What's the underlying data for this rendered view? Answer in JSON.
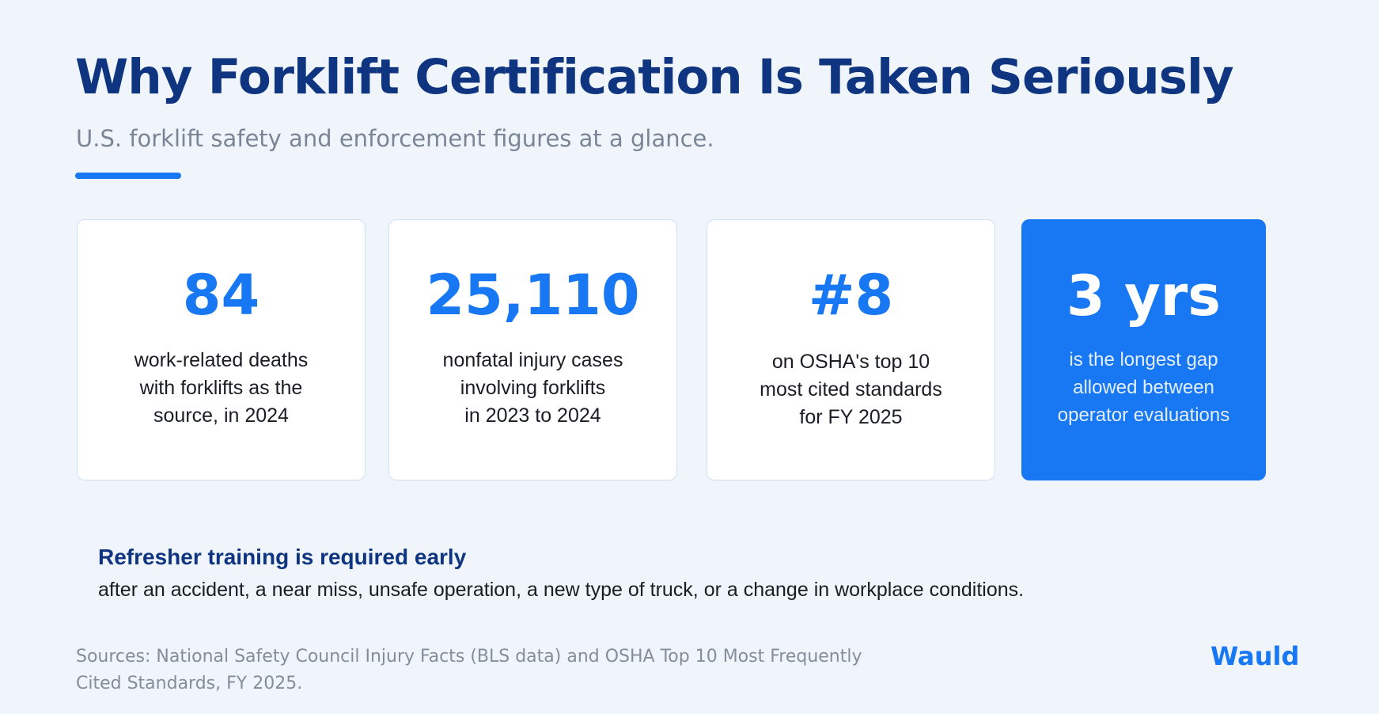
{
  "header": {
    "title": "Why Forklift Certification Is Taken Seriously",
    "subtitle": "U.S. forklift safety and enforcement figures at a glance."
  },
  "stats": [
    {
      "value": "84",
      "description": "work-related deaths with forklifts as the source, in 2024",
      "lines": [
        "work-related deaths",
        "with forklifts as the",
        "source, in 2024"
      ]
    },
    {
      "value": "25,110",
      "description": "nonfatal injury cases involving forklifts in 2023 to 2024",
      "lines": [
        "nonfatal injury cases",
        "involving forklifts",
        "in 2023 to 2024"
      ]
    },
    {
      "value": "#8",
      "description": "on OSHA's top 10 most cited standards for FY 2025",
      "lines": [
        "on OSHA's top 10",
        "most cited standards",
        "for FY 2025"
      ]
    },
    {
      "value": "3 yrs",
      "description": "is the longest gap allowed between operator evaluations",
      "lines": [
        "is the longest gap",
        "allowed between",
        "operator evaluations"
      ]
    }
  ],
  "refresher": {
    "title": "Refresher training is required early",
    "body": "after an accident, a near miss, unsafe operation, a new type of truck, or a change in workplace conditions."
  },
  "footer": {
    "sources": "Sources: National Safety Council Injury Facts (BLS data) and OSHA Top 10 Most Frequently Cited Standards, FY 2025.",
    "sources_lines": [
      "Sources: National Safety Council Injury Facts (BLS data) and OSHA Top 10 Most Frequently",
      "Cited Standards, FY 2025."
    ],
    "brand": "Wauld"
  },
  "colors": {
    "accent": "#1877f2",
    "title": "#0f3580",
    "highlight_card": "#1877f2",
    "highlight_text": "#ffffff"
  }
}
